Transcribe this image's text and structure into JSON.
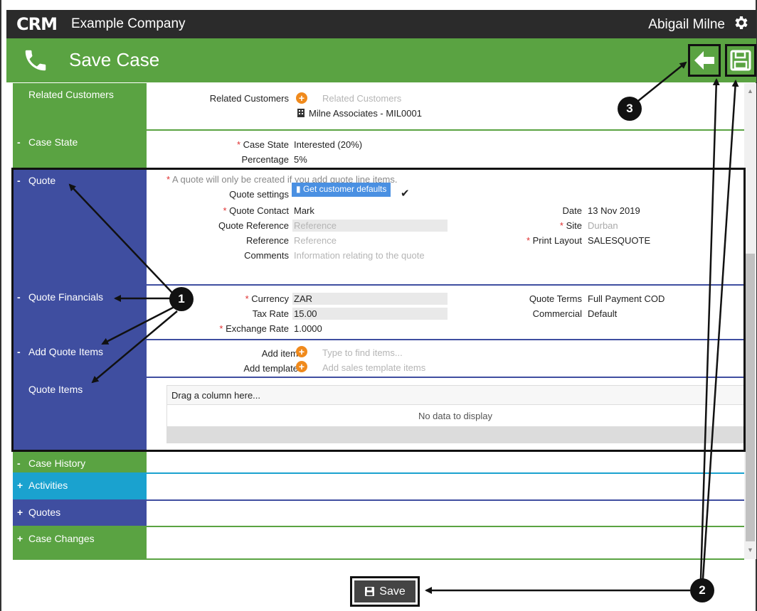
{
  "app": {
    "logo": "CRM",
    "company": "Example Company",
    "user": "Abigail Milne"
  },
  "header": {
    "title": "Save Case"
  },
  "sections": {
    "related_customers": {
      "heading": "Related Customers",
      "label": "Related Customers",
      "placeholder": "Related Customers",
      "customer": "Milne Associates - MIL0001"
    },
    "case_state": {
      "sign": "-",
      "heading": "Case State",
      "state_label": "Case State",
      "state_value": "Interested (20%)",
      "percentage_label": "Percentage",
      "percentage_value": "5%"
    },
    "quote": {
      "sign": "-",
      "heading": "Quote",
      "note": "A quote will only be created if you add quote line items.",
      "settings_label": "Quote settings",
      "get_defaults": "Get customer defaults",
      "contact_label": "Quote Contact",
      "contact_value": "Mark",
      "reference_label": "Quote Reference",
      "reference_placeholder": "Reference",
      "ref_label": "Reference",
      "ref_placeholder": "Reference",
      "comments_label": "Comments",
      "comments_placeholder": "Information relating to the quote",
      "date_label": "Date",
      "date_value": "13 Nov 2019",
      "site_label": "Site",
      "site_placeholder": "Durban",
      "print_label": "Print Layout",
      "print_value": "SALESQUOTE"
    },
    "quote_financials": {
      "sign": "-",
      "heading": "Quote Financials",
      "currency_label": "Currency",
      "currency_value": "ZAR",
      "tax_label": "Tax Rate",
      "tax_value": "15.00",
      "exchange_label": "Exchange Rate",
      "exchange_value": "1.0000",
      "terms_label": "Quote Terms",
      "terms_value": "Full Payment COD",
      "commercial_label": "Commercial",
      "commercial_value": "Default"
    },
    "add_quote_items": {
      "sign": "-",
      "heading": "Add Quote Items",
      "add_item_label": "Add item",
      "add_item_placeholder": "Type to find items...",
      "add_template_label": "Add template",
      "add_template_placeholder": "Add sales template items"
    },
    "quote_items": {
      "heading": "Quote Items",
      "grid_header": "Drag a column here...",
      "empty": "No data to display"
    },
    "case_history": {
      "sign": "-",
      "heading": "Case History"
    },
    "activities": {
      "sign": "+",
      "heading": "Activities"
    },
    "quotes": {
      "sign": "+",
      "heading": "Quotes"
    },
    "case_changes": {
      "sign": "+",
      "heading": "Case Changes"
    }
  },
  "footer": {
    "save_label": "Save"
  },
  "callouts": [
    "1",
    "2",
    "3"
  ],
  "colors": {
    "topbar": "#2b2b2b",
    "green": "#5aa342",
    "blue": "#3f4ea0",
    "cyan": "#1aa2cf",
    "orange": "#f08a1c",
    "button_blue": "#4a90e2"
  }
}
